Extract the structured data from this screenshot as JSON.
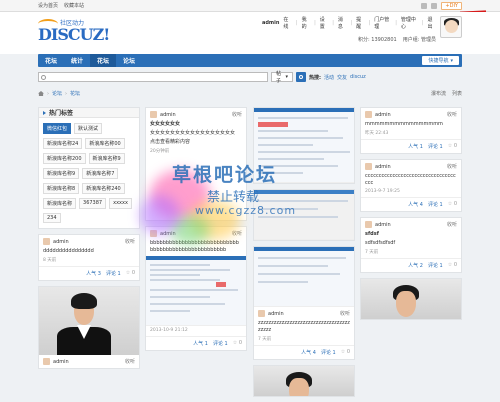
{
  "topbar": {
    "links": [
      "设为首页",
      "收藏本站"
    ],
    "diy": "+DIY"
  },
  "logo": {
    "text": "DISCUZ!",
    "subtitle": "社区动力"
  },
  "user": {
    "name": "admin",
    "online": "在线",
    "links": [
      "我的",
      "设置",
      "消息",
      "提醒",
      "门户管理",
      "管理中心",
      "退出"
    ],
    "credits_label": "积分: 13902801",
    "group_label": "用户组: 管理员"
  },
  "nav": {
    "items": [
      "花坛",
      "统计",
      "花坛",
      "论坛"
    ],
    "active_index": 2,
    "quick_nav": "快捷导航"
  },
  "search": {
    "scope": "帖子",
    "hot_label": "热搜:",
    "hot_items": [
      "活动",
      "交友",
      "discuz"
    ]
  },
  "breadcrumb": {
    "items": [
      "论坛",
      "花坛"
    ],
    "right": [
      "瀑布流",
      "列表"
    ]
  },
  "tags_panel": {
    "title": "热门标签",
    "tags": [
      "微信红包",
      "默认测试",
      "新浪库名称24",
      "新浪库名称00",
      "新浪库名称200",
      "新浪库名称9",
      "新浪库名称9",
      "新浪库名称7",
      "新浪库名称8",
      "新浪库名称240",
      "新浪库名称",
      "367387",
      "xxxxx",
      "234"
    ]
  },
  "posts": {
    "col1_a": {
      "author": "admin",
      "action": "收听",
      "body": "dddddddddddddddd",
      "time": "8 天前",
      "likes": "人气 3",
      "comments": "评论 1",
      "count": "0"
    },
    "col1_b": {
      "author": "admin",
      "action": "收听"
    },
    "col2_a": {
      "author": "admin",
      "action": "收听",
      "title": "女女女女女女",
      "body": "女女女女女女女女女女女女女女女女女",
      "extra": "点击查看精彩内容",
      "meta": "20分钟前"
    },
    "col2_b": {
      "author": "admin",
      "action": "收听",
      "body": "bbbbbbbbbbbbbbbbbbbbbbbbbbbbbbbbbbbbbbbbbbbbbbbbbbbb"
    },
    "col2_c": {
      "time": "2013-10-9 21:12",
      "likes": "人气 1",
      "comments": "评论 1",
      "count": "0"
    },
    "col3_a": {
      "author": "admin",
      "action": "收听",
      "body": "zzzzzzzzzzzzzzzzzzzzzzzzzzzzzzzzzzzzzzzz",
      "time": "7 天前",
      "likes": "人气 4",
      "comments": "评论 1",
      "count": "0"
    },
    "col4_a": {
      "author": "admin",
      "action": "收听",
      "body": "mmmmmmmmmmmmmmmm",
      "time": "昨天 22:43",
      "likes": "人气 1",
      "comments": "评论 1",
      "count": "0"
    },
    "col4_b": {
      "author": "admin",
      "action": "收听",
      "body": "cccccccccccccccccccccccccccccccccccc",
      "time": "2013-9-7 19:25",
      "likes": "人气 4",
      "comments": "评论 1",
      "count": "0"
    },
    "col4_c": {
      "author": "admin",
      "action": "收听",
      "body": "sfdsf",
      "body2": "sdfsdfsdfsdf",
      "time": "7 天前",
      "likes": "人气 2",
      "comments": "评论 1",
      "count": "0"
    }
  },
  "watermark": {
    "line1": "草根吧论坛",
    "line2": "禁止转载",
    "line3": "www.cgzz8.com"
  }
}
